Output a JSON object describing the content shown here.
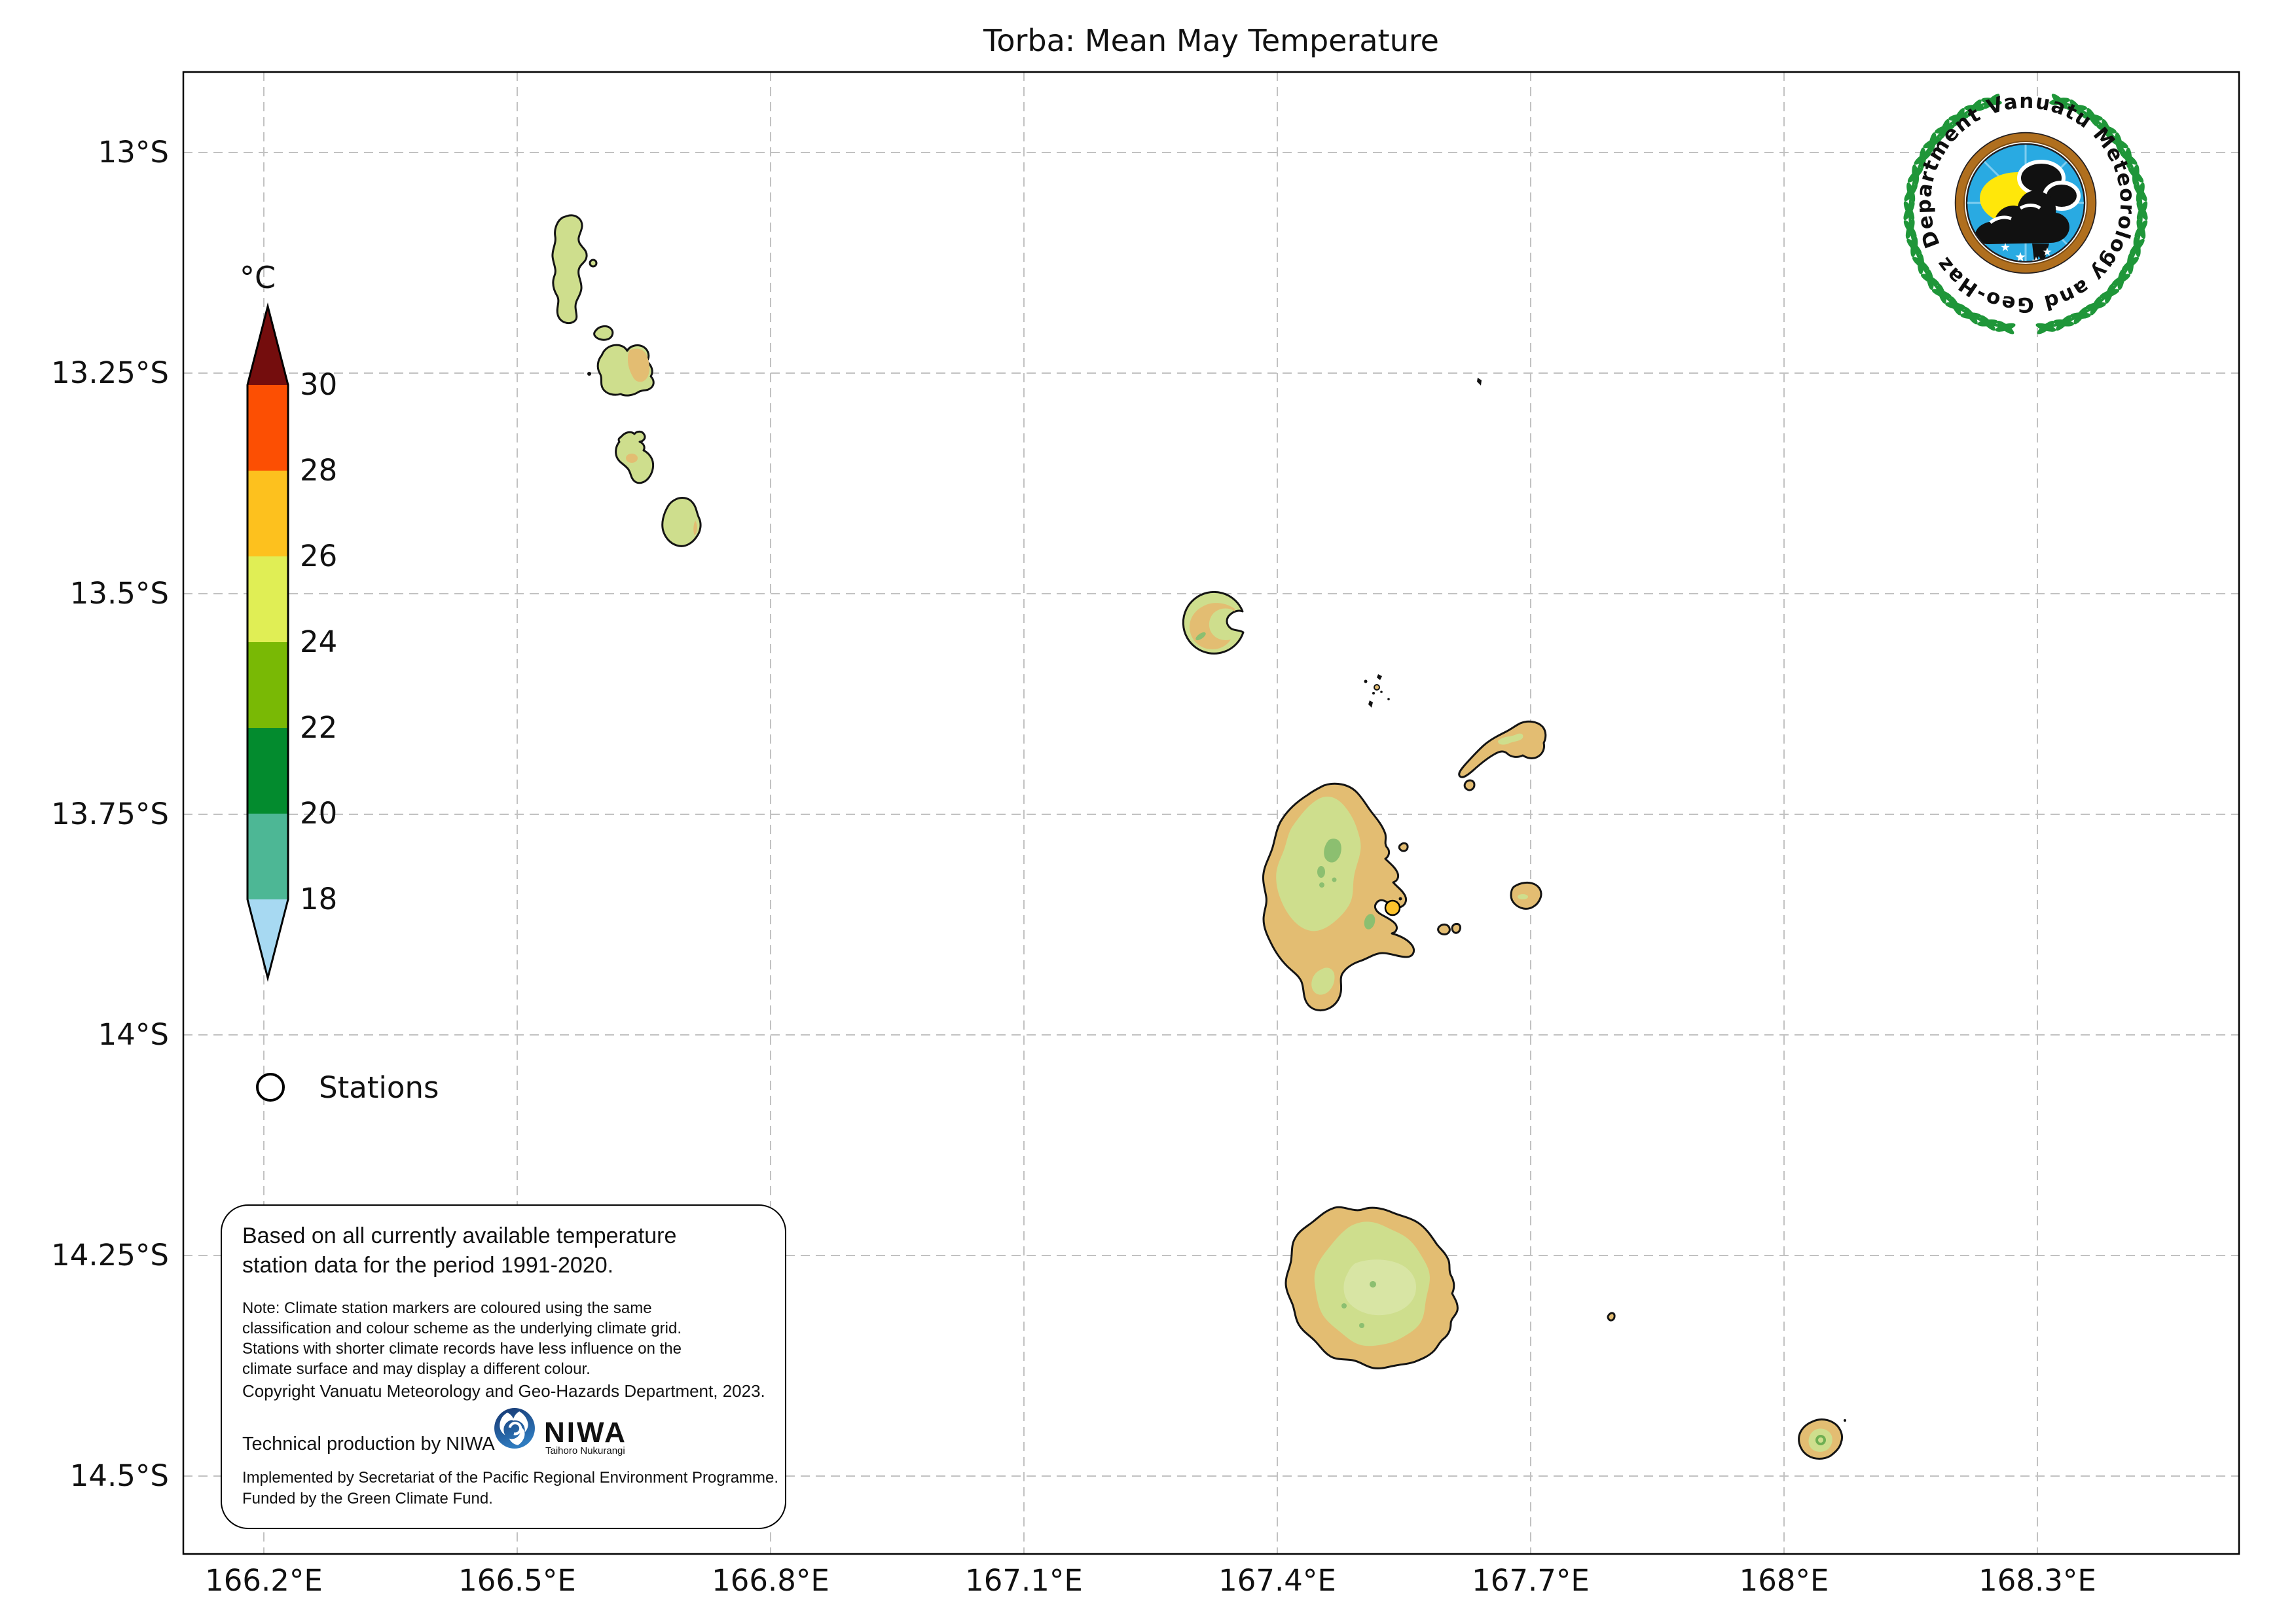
{
  "title": "Torba: Mean May Temperature",
  "colorbar": {
    "unit": "°C",
    "tick_labels": [
      "30",
      "28",
      "26",
      "24",
      "22",
      "20",
      "18"
    ],
    "band_colors": [
      "#fc4f03",
      "#fdc11e",
      "#e0ee55",
      "#79b905",
      "#038b2e",
      "#4db795"
    ],
    "over_color": "#740d0d",
    "under_color": "#a7d9f2"
  },
  "axes": {
    "x_tick_labels": [
      "166.2°E",
      "166.5°E",
      "166.8°E",
      "167.1°E",
      "167.4°E",
      "167.7°E",
      "168°E",
      "168.3°E"
    ],
    "y_tick_labels": [
      "13°S",
      "13.25°S",
      "13.5°S",
      "13.75°S",
      "14°S",
      "14.25°S",
      "14.5°S"
    ]
  },
  "legend": {
    "stations_label": "Stations"
  },
  "info_box": {
    "heading_lines": [
      "Based on all currently available temperature",
      "station data for the period 1991-2020."
    ],
    "note_lines": [
      "Note: Climate station markers are coloured using the same",
      "classification and colour scheme as the underlying climate grid.",
      "Stations with shorter climate records have less influence on the",
      "climate surface and may display a different colour."
    ],
    "copyright": "Copyright Vanuatu Meteorology and Geo-Hazards Department, 2023.",
    "production": "Technical production by NIWA",
    "footer_lines": [
      "Implemented by Secretariat of the Pacific Regional Environment Programme.",
      "Funded by the Green Climate Fund."
    ]
  },
  "niwa_logo": {
    "name": "NIWA",
    "tagline": "Taihoro Nukurangi"
  },
  "agency_logo": {
    "ring_text": "Department Vanuatu Meteorology and Geo-Hazards"
  },
  "map": {
    "land_low_color": "#cede8d",
    "land_coast_color": "#e3bd72",
    "land_high_color": "#8cbf70",
    "land_pale_color": "#d8e5a4",
    "station_marker_color": "#fdc32b",
    "gridline_color": "#c2c2c2"
  }
}
